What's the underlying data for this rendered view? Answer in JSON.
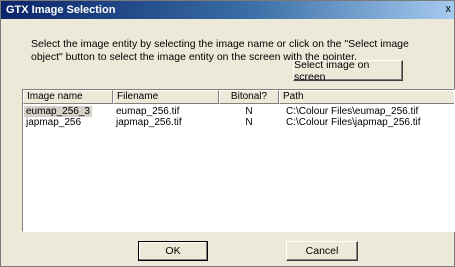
{
  "window": {
    "title": "GTX Image Selection",
    "close_glyph": "x"
  },
  "instructions": "Select the image entity by selecting the image name or click on the \"Select image object\" button to select the image entity on the screen with the pointer.",
  "buttons": {
    "select_on_screen": "Select image on screen",
    "ok": "OK",
    "cancel": "Cancel"
  },
  "table": {
    "columns": [
      "Image name",
      "Filename",
      "Bitonal?",
      "Path"
    ],
    "rows": [
      {
        "image_name": "eumap_256_3",
        "filename": "eumap_256.tif",
        "bitonal": "N",
        "path": "C:\\Colour Files\\eumap_256.tif",
        "selected": true
      },
      {
        "image_name": "japmap_256",
        "filename": "japmap_256.tif",
        "bitonal": "N",
        "path": "C:\\Colour Files\\japmap_256.tif",
        "selected": false
      }
    ]
  }
}
